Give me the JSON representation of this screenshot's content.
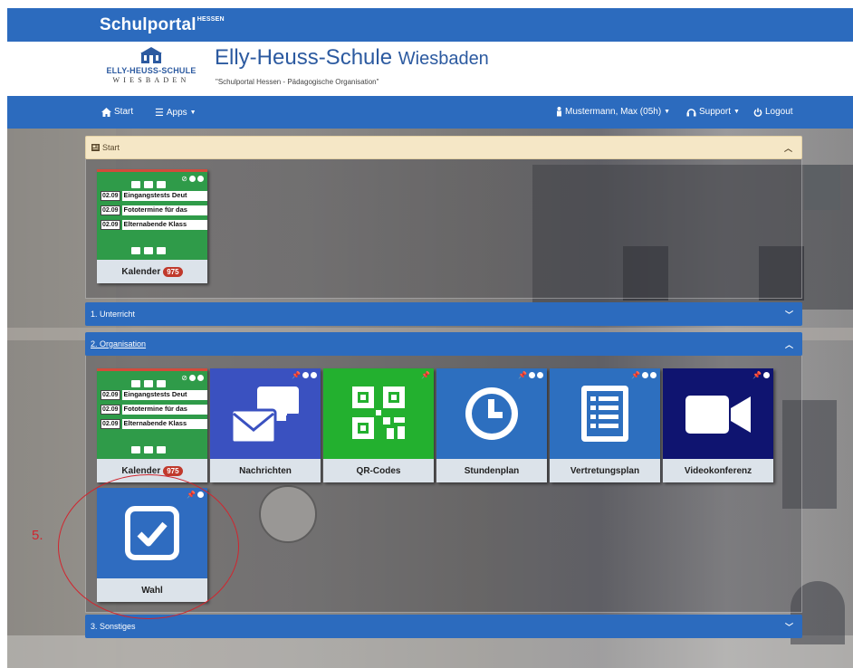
{
  "portal": {
    "name": "Schulportal",
    "name_sup": "HESSEN"
  },
  "school": {
    "logo_name": "ELLY-HEUSS-SCHULE",
    "logo_city": "WIESBADEN",
    "title": "Elly-Heuss-Schule",
    "title_town": "Wiesbaden",
    "subtitle": "\"Schulportal Hessen - Pädagogische Organisation\""
  },
  "nav": {
    "start": "Start",
    "apps": "Apps",
    "user": "Mustermann, Max (05h)",
    "support": "Support",
    "logout": "Logout"
  },
  "panels": {
    "start": "Start",
    "unterricht": "1. Unterricht",
    "organisation": "2. Organisation",
    "sonstiges": "3. Sonstiges"
  },
  "calendar": {
    "label": "Kalender",
    "badge": "975",
    "events": [
      {
        "date": "02.09",
        "text": "Eingangstests Deut"
      },
      {
        "date": "02.09",
        "text": "Fototermine für das"
      },
      {
        "date": "02.09",
        "text": "Elternabende Klass"
      }
    ]
  },
  "tiles": {
    "nachrichten": "Nachrichten",
    "qrcodes": "QR-Codes",
    "stundenplan": "Stundenplan",
    "vertretungsplan": "Vertretungsplan",
    "videokonferenz": "Videokonferenz",
    "wahl": "Wahl"
  },
  "annotation": {
    "number": "5."
  },
  "colors": {
    "portal_blue": "#2c6bbe",
    "calendar_green": "#2f9b49",
    "nachrichten_blue": "#3a51c0",
    "qr_green": "#23b02f",
    "stundenplan_blue": "#2d6fbf",
    "video_navy": "#0f1470",
    "wahl_blue": "#2f6cc0",
    "annotation_red": "#d0262f"
  }
}
